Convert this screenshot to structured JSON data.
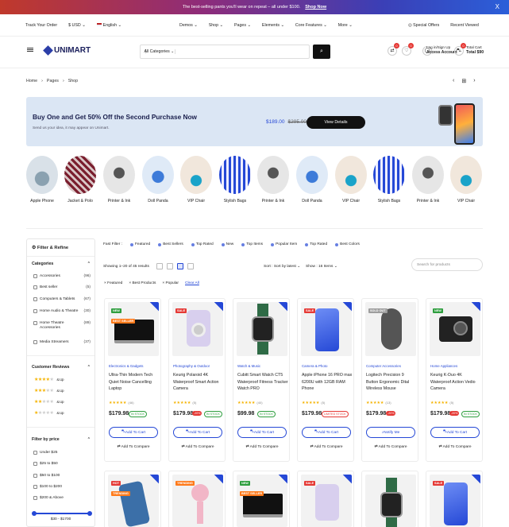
{
  "promo": {
    "text": "The best-selling pants you'll wear on repeat – all under $100.",
    "link": "Shop Now",
    "close": "X"
  },
  "topnav": {
    "track": "Track Your Order",
    "currency": "$ USD ⌄",
    "language": "English ⌄",
    "menu": [
      "Demos ⌄",
      "Shop ⌄",
      "Pages ⌄",
      "Elements ⌄",
      "Core Features ⌄",
      "More ⌄"
    ],
    "special": "Special Offers",
    "recent": "Recent Viewed"
  },
  "header": {
    "logo": "UNIMART",
    "search_category": "All Categories ⌄",
    "search_value": "|",
    "search_btn": "⌕",
    "badge_a": "0",
    "badge_b": "0",
    "badge_c": "0",
    "account_top": "Log in/Sign Up",
    "account_bottom": "Access Account",
    "cart_top": "Total Cart",
    "cart_bottom": "Total $90"
  },
  "breadcrumb": [
    "Home",
    "›",
    "Pages",
    "›",
    "Shop"
  ],
  "banner": {
    "title": "Buy One and Get 50% Off the Second Purchase Now",
    "subtitle": "Send us your idea, it may appear on Unimart.",
    "price": "$189.00",
    "old_price": "$295.00",
    "button": "View Details"
  },
  "categories": [
    "Apple Phone",
    "Jacket & Polo",
    "Printer & Ink",
    "Doll Panda",
    "VIP Chair",
    "Stylish Bags",
    "Printer & Ink",
    "Doll Panda",
    "VIP Chair",
    "Stylish Bags",
    "Printer & Ink",
    "VIP Chair"
  ],
  "sidebar": {
    "title": "Filter & Refine",
    "cat_title": "Categories",
    "cats": [
      {
        "name": "Accessories",
        "count": "(96)"
      },
      {
        "name": "Best seller",
        "count": "(5)"
      },
      {
        "name": "Computers & Tablets",
        "count": "(67)"
      },
      {
        "name": "Home Audio & Theatre",
        "count": "(30)"
      },
      {
        "name": "Home Theatre Accessories",
        "count": "(89)"
      },
      {
        "name": "Media Streamers",
        "count": "(37)"
      }
    ],
    "rev_title": "Customer Reviews",
    "rev": [
      "& Up",
      "& Up",
      "& Up",
      "& Up"
    ],
    "price_title": "Filter by price",
    "prices": [
      "Under $25",
      "$25 to $50",
      "$50 to $100",
      "$100 to $200",
      "$200 & Above"
    ],
    "price_range": "$30 - $1700"
  },
  "fast_filter": {
    "label": "Fast Filter :",
    "chips": [
      "Featured",
      "Best Sellers",
      "Top Rated",
      "New",
      "Top Items",
      "Popular Item",
      "Top Rated",
      "Best Colors"
    ]
  },
  "sortbar": {
    "showing": "Showing 1–20 of 45 results",
    "sort_label": "Sort :",
    "sort_value": "Sort by latest ⌄",
    "show_label": "Show :",
    "show_value": "16 Items ⌄",
    "search_placeholder": "Search for products"
  },
  "tags": [
    "× Featured",
    "× Best Products",
    "× Popular"
  ],
  "clear_all": "Clear All",
  "products": [
    {
      "category": "Electronics & Gadgets",
      "name": "Ultra-Thin Modern Tech Quiet Noise Cancelling Laptop",
      "reviews": "(46)",
      "price": "$179.98",
      "status": "IN STOCK",
      "button": "Add To Cart",
      "compare": "Add To Compare",
      "badges": [
        "NEW",
        "BEST SELLER"
      ]
    },
    {
      "category": "Photography & Outdoor",
      "name": "Keurig Polaroid 4K Waterproof Smart Action Camera",
      "reviews": "(5)",
      "price": "$179.98",
      "discount": "-20%",
      "status": "IN STOCK",
      "button": "Add To Cart",
      "compare": "Add To Compare",
      "badges": [
        "SALE"
      ]
    },
    {
      "category": "Watch & Music",
      "name": "Cubitt Smart Watch CT5 Waterproof Fitness Tracker Watch PRO",
      "reviews": "(40)",
      "price": "$99.98",
      "status": "IN STOCK",
      "button": "Add To Cart",
      "compare": "Add To Compare",
      "badges": []
    },
    {
      "category": "Camera & Photo",
      "name": "Apple iPhone 16 PRO max 6200U with 12GB RAM Phone",
      "reviews": "(5)",
      "price": "$179.98",
      "status": "LIMITED STOCK",
      "button": "Add To Cart",
      "compare": "Add To Compare",
      "badges": [
        "SALE"
      ]
    },
    {
      "category": "Computer Accessories",
      "name": "Logitech Precision 9 Button Ergonomic Dital Wireless Mouse",
      "reviews": "(13)",
      "price": "$179.98",
      "discount": "-20%",
      "button": "Notify Me",
      "compare": "Add To Compare",
      "badges": [
        "SOLD OUT"
      ]
    },
    {
      "category": "Home Appliances",
      "name": "Keurig K-Duo 4K Waterproof Action Vedio Camera",
      "reviews": "(5)",
      "price": "$179.98",
      "discount": "-20%",
      "status": "IN STOCK",
      "button": "Add To Cart",
      "compare": "Add To Compare",
      "badges": [
        "NEW"
      ]
    }
  ],
  "row2_badges": [
    [
      "HOT",
      "TRENDING"
    ],
    [
      "TRENDING"
    ],
    [
      "NEW",
      "BEST SELLER"
    ],
    [
      "SALE"
    ],
    [],
    [
      "SALE"
    ]
  ],
  "colors": {
    "accent": "#2548d6",
    "sale": "#e53935",
    "new": "#2e9e3e",
    "hot": "#ff7a1a",
    "star": "#f5b301"
  }
}
